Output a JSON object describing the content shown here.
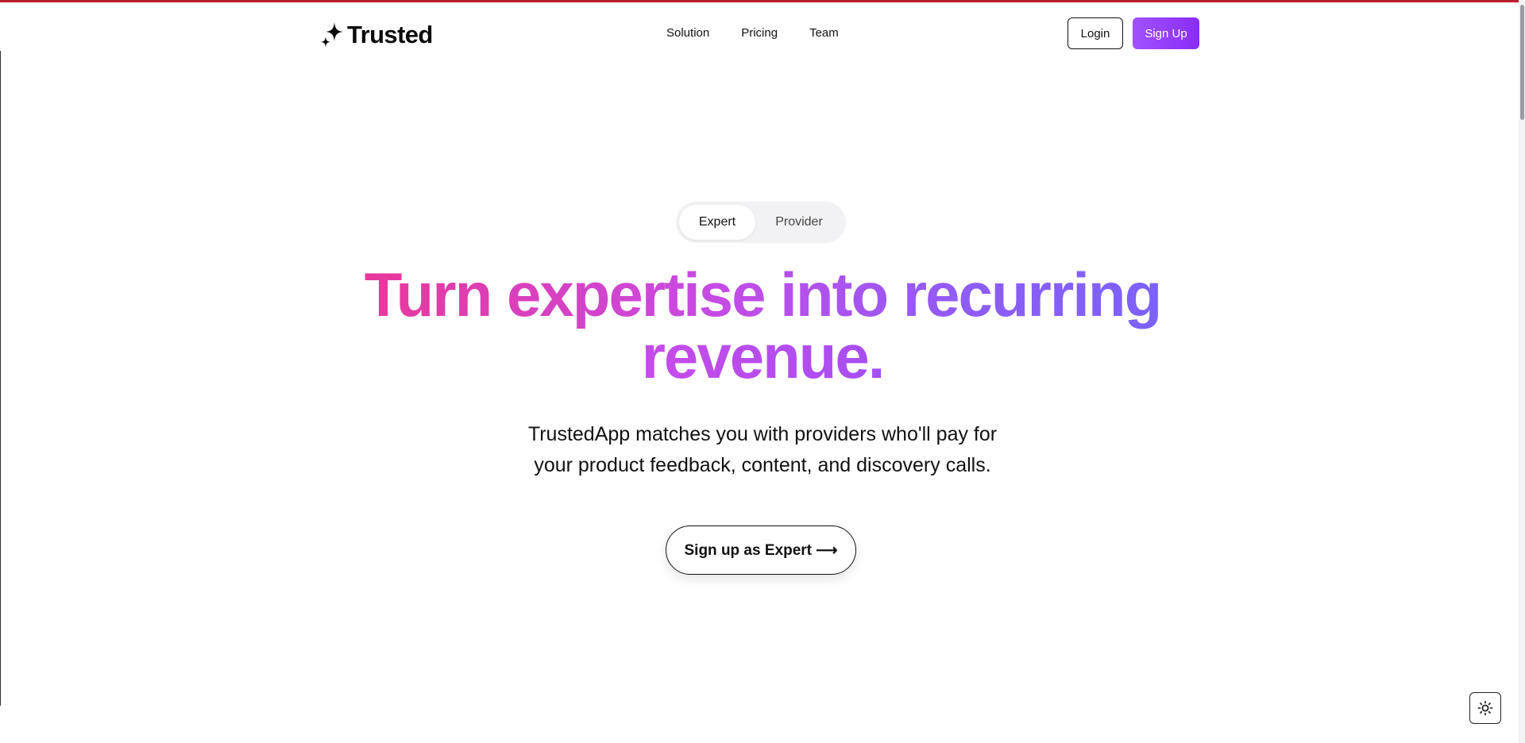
{
  "brand": {
    "name": "Trusted",
    "logo_icon": "sparkle-icon"
  },
  "nav": {
    "items": [
      {
        "label": "Solution"
      },
      {
        "label": "Pricing"
      },
      {
        "label": "Team"
      }
    ]
  },
  "auth": {
    "login_label": "Login",
    "signup_label": "Sign Up"
  },
  "hero": {
    "toggle": {
      "options": [
        "Expert",
        "Provider"
      ],
      "selected": "Expert"
    },
    "headline_line1": "Turn expertise into recurring",
    "headline_line2": "revenue.",
    "subtitle_line1": "TrustedApp matches you with providers who'll pay for",
    "subtitle_line2": "your product feedback, content, and discovery calls.",
    "cta_label": "Sign up as Expert ⟶"
  },
  "theme_toggle": {
    "icon": "sun-icon"
  },
  "colors": {
    "accent_gradient_start": "#e9389b",
    "accent_gradient_end": "#7b62f7",
    "signup_button": "#9b45fb",
    "top_strip": "#b8222e"
  }
}
